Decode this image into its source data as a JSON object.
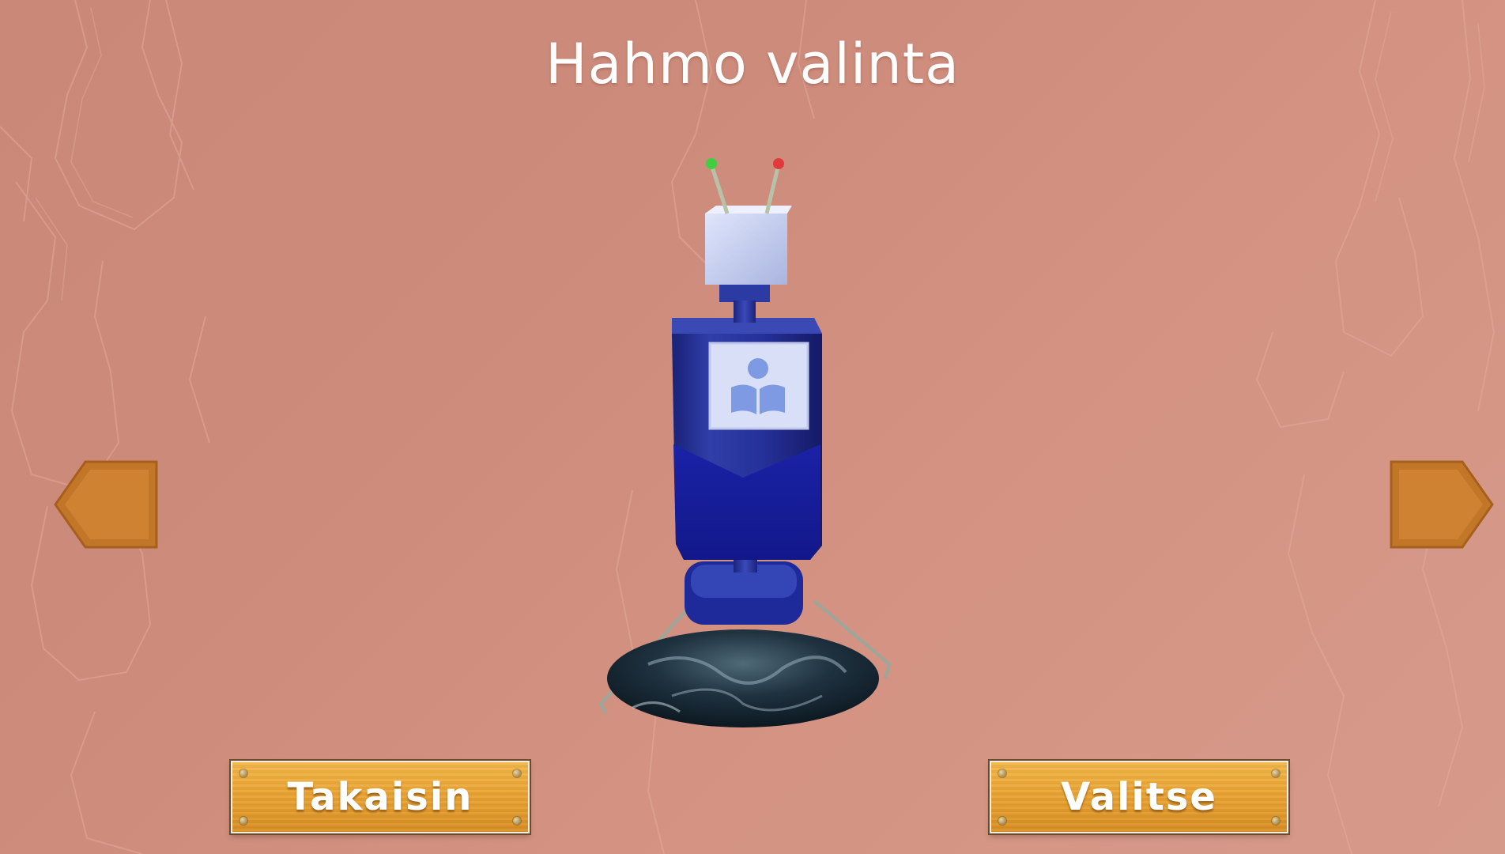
{
  "screen": {
    "title": "Hahmo valinta",
    "background_color": "#cd8b7b"
  },
  "character": {
    "icon": "robot-character-icon",
    "emblem_icon": "reading-book-icon",
    "body_color": "#1e2a8c",
    "head_color": "#c9d2f2",
    "antenna_left_color": "#3fcf3f",
    "antenna_right_color": "#e23a3a"
  },
  "navigation": {
    "prev_icon": "arrow-left-icon",
    "next_icon": "arrow-right-icon",
    "arrow_color": "#c87b2e"
  },
  "buttons": {
    "back_label": "Takaisin",
    "select_label": "Valitse",
    "plank_color": "#e9a332"
  }
}
